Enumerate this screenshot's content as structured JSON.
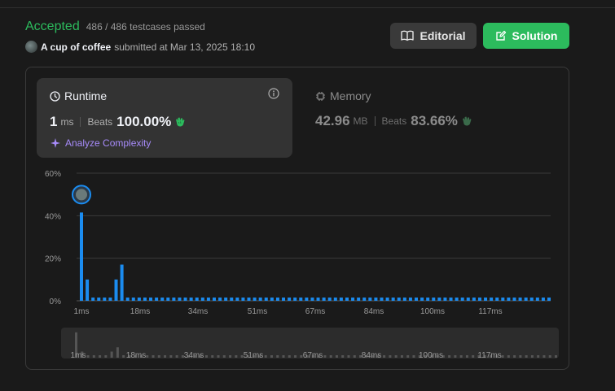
{
  "header": {
    "status": "Accepted",
    "testcases": "486 / 486 testcases passed",
    "username": "A cup of coffee",
    "submitted": "submitted at Mar 13, 2025 18:10",
    "editorial_label": "Editorial",
    "solution_label": "Solution"
  },
  "runtime": {
    "title": "Runtime",
    "value": "1",
    "unit": "ms",
    "beats_label": "Beats",
    "beats": "100.00%",
    "analyze_label": "Analyze Complexity"
  },
  "memory": {
    "title": "Memory",
    "value": "42.96",
    "unit": "MB",
    "beats_label": "Beats",
    "beats": "83.66%"
  },
  "colors": {
    "accepted": "#2cbb5d",
    "bar": "#1b8cf0",
    "analyze": "#a78bfa"
  },
  "chart_data": {
    "type": "bar",
    "y_ticks": [
      "60%",
      "40%",
      "20%",
      "0%"
    ],
    "ylim": [
      0,
      60
    ],
    "x_ticks": [
      "1ms",
      "18ms",
      "34ms",
      "51ms",
      "67ms",
      "84ms",
      "100ms",
      "117ms"
    ],
    "highlight_index": 0,
    "values": [
      41.5,
      10,
      1.5,
      1.5,
      1.5,
      1.5,
      10,
      17,
      1.5,
      1.5,
      1.5,
      1.5,
      1.5,
      1.5,
      1.5,
      1.5,
      1.5,
      1.5,
      1.5,
      1.5,
      1.5,
      1.5,
      1.5,
      1.5,
      1.5,
      1.5,
      1.5,
      1.5,
      1.5,
      1.5,
      1.5,
      1.5,
      1.5,
      1.5,
      1.5,
      1.5,
      1.5,
      1.5,
      1.5,
      1.5,
      1.5,
      1.5,
      1.5,
      1.5,
      1.5,
      1.5,
      1.5,
      1.5,
      1.5,
      1.5,
      1.5,
      1.5,
      1.5,
      1.5,
      1.5,
      1.5,
      1.5,
      1.5,
      1.5,
      1.5,
      1.5,
      1.5,
      1.5,
      1.5,
      1.5,
      1.5,
      1.5,
      1.5,
      1.5,
      1.5,
      1.5,
      1.5,
      1.5,
      1.5,
      1.5,
      1.5,
      1.5,
      1.5,
      1.5,
      1.5,
      1.5,
      1.5
    ]
  }
}
